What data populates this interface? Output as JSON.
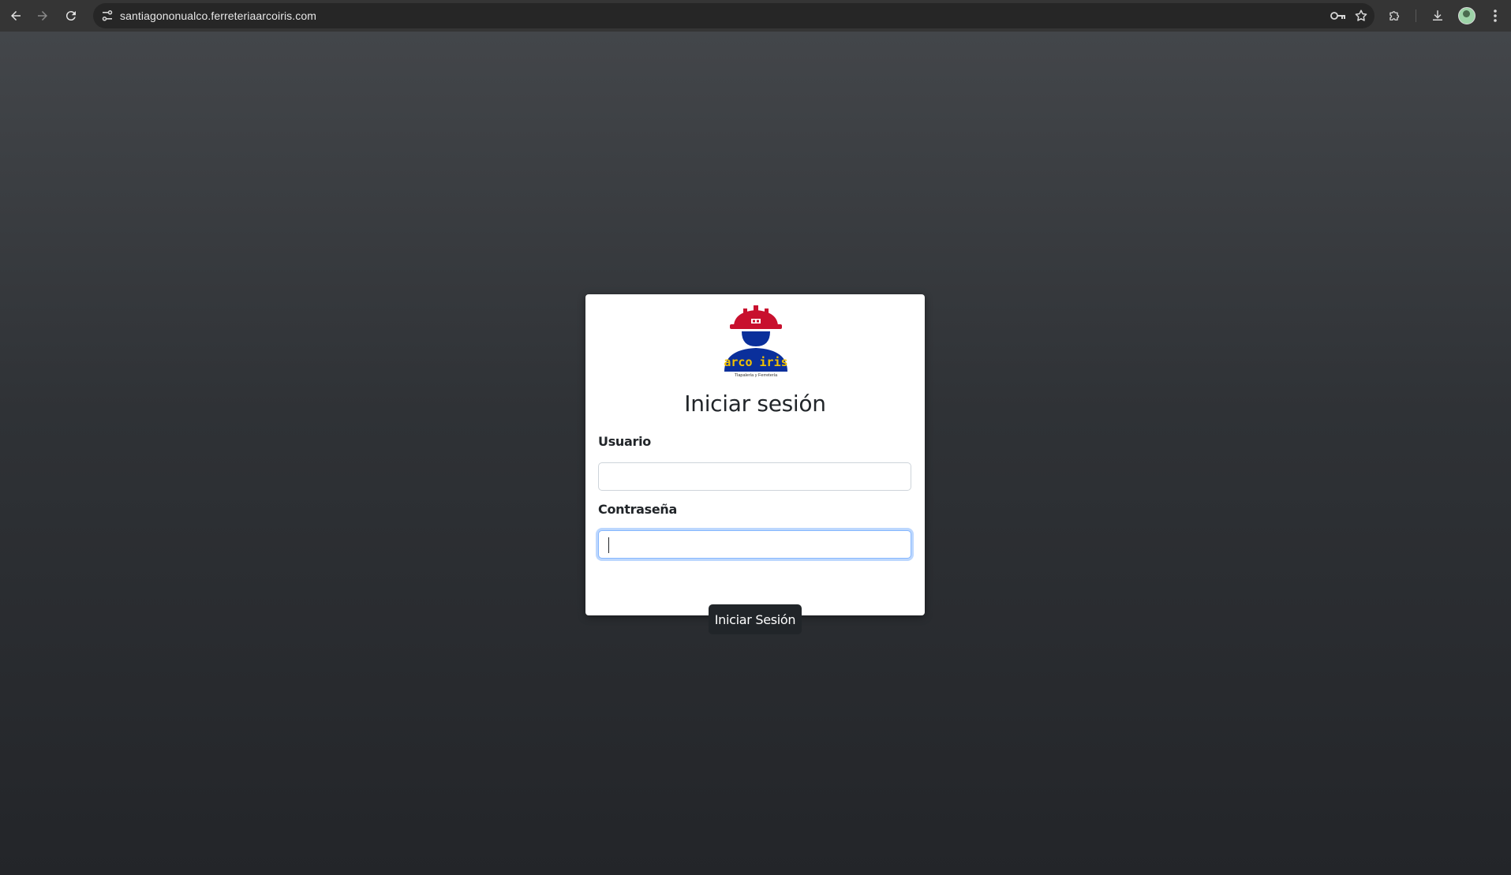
{
  "browser": {
    "url": "santiagononualco.ferreteriaarcoiris.com",
    "icons": {
      "back": "back-arrow-icon",
      "forward": "forward-arrow-icon",
      "reload": "reload-icon",
      "site_info": "tune-icon",
      "password": "key-icon",
      "bookmark": "star-icon",
      "extensions": "puzzle-icon",
      "downloads": "download-icon",
      "profile": "avatar",
      "menu": "kebab-menu-icon"
    }
  },
  "login": {
    "logo_text": "arco iris",
    "logo_subtext": "Tlapalería y Ferretería",
    "title": "Iniciar sesión",
    "username_label": "Usuario",
    "username_value": "",
    "password_label": "Contraseña",
    "password_value": "",
    "submit_label": "Iniciar Sesión"
  },
  "colors": {
    "button_bg": "#212529",
    "focus_ring": "#86b7fe",
    "helmet_red": "#c8102e",
    "figure_blue": "#0a2f9b"
  }
}
